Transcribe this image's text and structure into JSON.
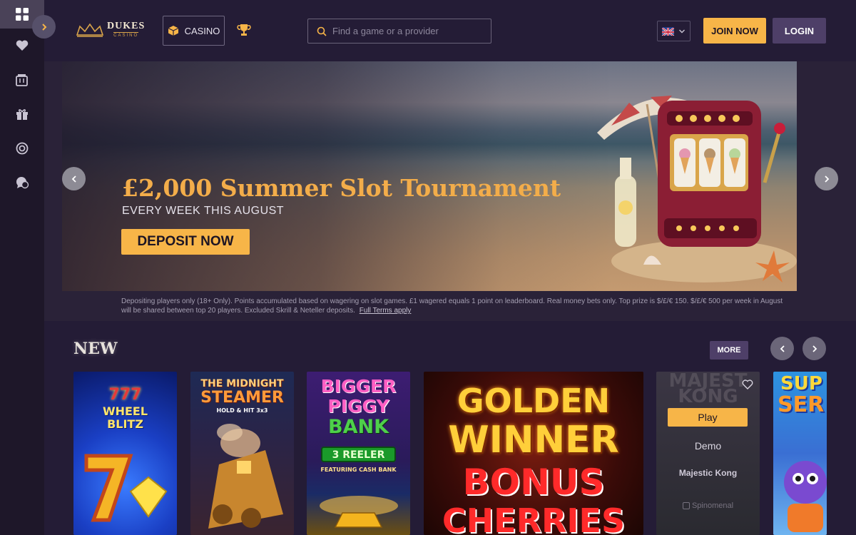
{
  "header": {
    "logo_main": "DUKES",
    "logo_sub": "CASINO",
    "casino_label": "CASINO",
    "search_placeholder": "Find a game or a provider",
    "join_label": "JOIN NOW",
    "login_label": "LOGIN"
  },
  "sidebar": {
    "items": [
      {
        "icon": "grid-icon",
        "active": true
      },
      {
        "icon": "heart-icon"
      },
      {
        "icon": "slot-machine-icon"
      },
      {
        "icon": "gift-icon"
      },
      {
        "icon": "lifebuoy-icon"
      },
      {
        "icon": "chat-help-icon"
      }
    ]
  },
  "banner": {
    "title": "£2,000 Summer Slot Tournament",
    "subtitle": "EVERY WEEK THIS AUGUST",
    "cta_label": "DEPOSIT NOW",
    "terms": "Depositing players only (18+ Only). Points accumulated based on wagering on slot games. £1 wagered equals 1 point on leaderboard. Real money bets only. Top prize is $/£/€ 150. $/£/€ 500 per week in August will be shared between top 20 players. Excluded Skrill & Neteller deposits.",
    "terms_link": "Full Terms apply"
  },
  "new_section": {
    "title": "NEW",
    "more_label": "MORE",
    "tiles": [
      {
        "title_lines": [
          "777",
          "WHEEL",
          "BLITZ"
        ]
      },
      {
        "title_lines": [
          "THE MIDNIGHT",
          "STEAMER",
          "HOLD & HIT 3x3"
        ]
      },
      {
        "title_lines": [
          "BIGGER",
          "PIGGY",
          "BANK",
          "3 REELER",
          "FEATURING CASH BANK"
        ]
      },
      {
        "title_lines": [
          "GOLDEN",
          "WINNER",
          "BONUS",
          "CHERRIES"
        ]
      },
      {
        "art_text": [
          "MAJEST",
          "KONG"
        ],
        "play_label": "Play",
        "demo_label": "Demo",
        "name": "Majestic Kong",
        "provider": "Spinomenal"
      },
      {
        "title_lines": [
          "SUP",
          "SER"
        ]
      }
    ]
  },
  "colors": {
    "accent": "#f7b548",
    "secondary_button": "#4e3f68",
    "background": "#241c36",
    "sidebar": "#1e1729"
  }
}
